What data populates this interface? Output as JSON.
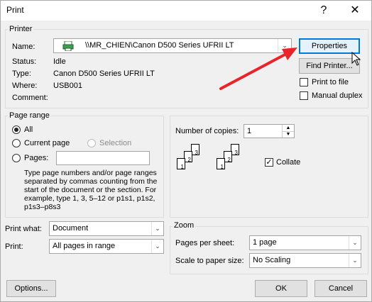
{
  "window": {
    "title": "Print",
    "help": "?",
    "close": "✕"
  },
  "printer": {
    "group_label": "Printer",
    "name_label": "Name:",
    "name_value": "\\\\MR_CHIEN\\Canon D500 Series UFRII LT",
    "status_label": "Status:",
    "status_value": "Idle",
    "type_label": "Type:",
    "type_value": "Canon D500 Series UFRII LT",
    "where_label": "Where:",
    "where_value": "USB001",
    "comment_label": "Comment:",
    "comment_value": "",
    "properties_button": "Properties",
    "find_printer_button": "Find Printer...",
    "print_to_file_label": "Print to file",
    "manual_duplex_label": "Manual duplex"
  },
  "page_range": {
    "group_label": "Page range",
    "all_label": "All",
    "current_page_label": "Current page",
    "selection_label": "Selection",
    "pages_label": "Pages:",
    "pages_value": "",
    "help_text": "Type page numbers and/or page ranges separated by commas counting from the start of the document or the section. For example, type 1, 3, 5–12 or p1s1, p1s2, p1s3–p8s3"
  },
  "copies": {
    "number_label": "Number of copies:",
    "number_value": "1",
    "collate_label": "Collate",
    "collate_checked": true
  },
  "print_what": {
    "label": "Print what:",
    "value": "Document"
  },
  "print": {
    "label": "Print:",
    "value": "All pages in range"
  },
  "zoom": {
    "group_label": "Zoom",
    "pages_per_sheet_label": "Pages per sheet:",
    "pages_per_sheet_value": "1 page",
    "scale_label": "Scale to paper size:",
    "scale_value": "No Scaling"
  },
  "footer": {
    "options_button": "Options...",
    "ok_button": "OK",
    "cancel_button": "Cancel"
  },
  "collate_pages": {
    "stack": [
      "1",
      "2",
      "3"
    ]
  },
  "colors": {
    "annotation_arrow": "#e8232a",
    "focus_border": "#0078d7"
  }
}
